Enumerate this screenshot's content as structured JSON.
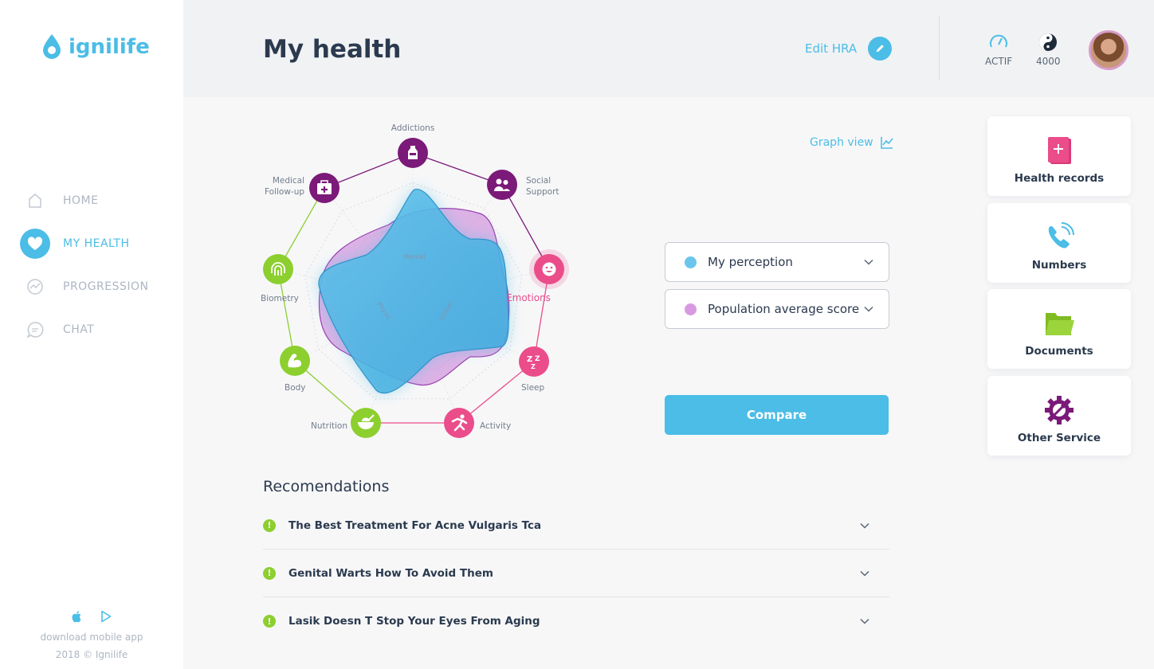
{
  "app": {
    "brand": "ignilife"
  },
  "sidebar": {
    "items": [
      {
        "label": "HOME",
        "icon": "home-icon",
        "active": false
      },
      {
        "label": "MY HEALTH",
        "icon": "heart-icon",
        "active": true
      },
      {
        "label": "PROGRESSION",
        "icon": "progression-icon",
        "active": false
      },
      {
        "label": "CHAT",
        "icon": "chat-icon",
        "active": false
      }
    ],
    "download_text": "download mobile app",
    "copyright": "2018 © Ignilife",
    "store_icons": [
      "apple-icon",
      "google-play-icon"
    ]
  },
  "header": {
    "title": "My health",
    "edit_label": "Edit HRA",
    "stats": [
      {
        "icon": "gauge-icon",
        "label": "ACTIF"
      },
      {
        "icon": "yin-yang-icon",
        "label": "4000"
      }
    ]
  },
  "radar": {
    "axes": [
      {
        "label": "Addictions",
        "color": "#7b1a78",
        "icon": "bottle-icon"
      },
      {
        "label": "Social\nSupport",
        "color": "#7b1a78",
        "icon": "people-icon"
      },
      {
        "label": "Emotions",
        "color": "#ea4d8a",
        "icon": "smile-icon"
      },
      {
        "label": "Sleep",
        "color": "#ea4d8a",
        "icon": "sleep-icon"
      },
      {
        "label": "Activity",
        "color": "#ea4d8a",
        "icon": "running-icon"
      },
      {
        "label": "Nutrition",
        "color": "#8ccf2f",
        "icon": "bowl-icon"
      },
      {
        "label": "Body",
        "color": "#8ccf2f",
        "icon": "muscle-icon"
      },
      {
        "label": "Biometry",
        "color": "#8ccf2f",
        "icon": "fingerprint-icon"
      },
      {
        "label": "Medical\nFollow-up",
        "color": "#7b1a78",
        "icon": "medical-kit-icon"
      }
    ],
    "inner_labels": {
      "mental": "Mental",
      "physic": "Physic",
      "global": "Global"
    }
  },
  "graph_view_label": "Graph view",
  "compare": {
    "selects": [
      {
        "label": "My perception",
        "color": "#6cc6ec"
      },
      {
        "label": "Population average score",
        "color": "#d79ae0"
      }
    ],
    "button": "Compare"
  },
  "recommendations": {
    "title": "Recomendations",
    "items": [
      "The Best Treatment For Acne Vulgaris Tca",
      "Genital Warts How To Avoid Them",
      "Lasik Doesn T Stop Your Eyes From Aging"
    ]
  },
  "cards": [
    {
      "label": "Health records",
      "icon": "health-book-icon",
      "color": "#ea4d8a"
    },
    {
      "label": "Numbers",
      "icon": "phone-icon",
      "color": "#4bbde6"
    },
    {
      "label": "Documents",
      "icon": "folder-icon",
      "color": "#8ccf2f"
    },
    {
      "label": "Other Service",
      "icon": "gear-tools-icon",
      "color": "#7b1a78"
    }
  ]
}
